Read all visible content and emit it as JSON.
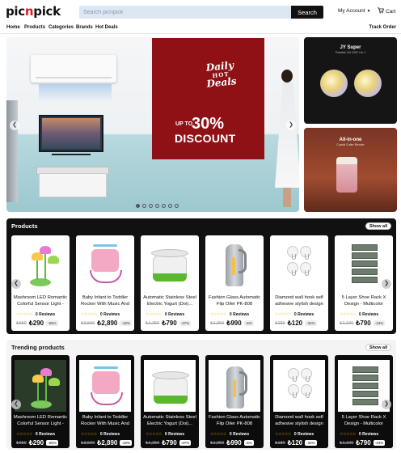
{
  "header": {
    "logo": {
      "part1": "pic",
      "part2": "n",
      "part3": "pick"
    },
    "search": {
      "placeholder": "Search picnpick",
      "button": "Search"
    },
    "account": "My Account",
    "cart": "Cart"
  },
  "nav": {
    "links": [
      "Home",
      "Products",
      "Categories",
      "Brands",
      "Hot Deals"
    ],
    "track": "Track Order"
  },
  "hero": {
    "promo": {
      "daily": "Daily",
      "hot": "HOT",
      "deals": "Deals",
      "up_to": "UP TO",
      "percent": "30%",
      "discount": "DISCOUNT"
    },
    "slide_count": 7,
    "active_slide": 1,
    "side_banners": [
      {
        "title": "JY Super",
        "subtitle": "Portable JUI GHR 4 in 1"
      },
      {
        "title": "All-in-one",
        "subtitle": "Crystal Cutter Blender"
      }
    ]
  },
  "sections": {
    "products": {
      "title": "Products",
      "show_all": "Show all"
    },
    "trending": {
      "title": "Trending products",
      "show_all": "Show all"
    }
  },
  "products": [
    {
      "name": "Mashroom LED Romantic Colorful Sensor Light -",
      "rating_stars": "☆☆☆☆☆",
      "reviews": "0 Reviews",
      "old_price": "₺650",
      "price": "₺290",
      "discount": "-55%"
    },
    {
      "name": "Baby Infant to Toddler Rocker With Music And",
      "rating_stars": "☆☆☆☆☆",
      "reviews": "0 Reviews",
      "old_price": "₺3,500",
      "price": "₺2,890",
      "discount": "-18%"
    },
    {
      "name": "Automatic Stainless Steel Electric Yogurt (Doi)...",
      "rating_stars": "☆☆☆☆☆",
      "reviews": "0 Reviews",
      "old_price": "₺1,250",
      "price": "₺790",
      "discount": "-37%"
    },
    {
      "name": "Fashion Glass Automatic Flip Oiler PK-808",
      "rating_stars": "☆☆☆☆☆",
      "reviews": "0 Reviews",
      "old_price": "₺1,050",
      "price": "₺990",
      "discount": "-6%"
    },
    {
      "name": "Diamond wall hook self adhesive stylish design",
      "rating_stars": "☆☆☆☆☆",
      "reviews": "0 Reviews",
      "old_price": "₺180",
      "price": "₺120",
      "discount": "-34%"
    },
    {
      "name": "5 Layer Shoe Rack X Design - Multicolor",
      "rating_stars": "☆☆☆☆☆",
      "reviews": "0 Reviews",
      "old_price": "₺1,190",
      "price": "₺790",
      "discount": "-34%"
    }
  ],
  "trending": [
    {
      "name": "Mashroom LED Romantic Colorful Sensor Light -",
      "rating_stars": "☆☆☆☆☆",
      "reviews": "0 Reviews",
      "old_price": "₺650",
      "price": "₺290",
      "discount": "-55%"
    },
    {
      "name": "Baby Infant to Toddler Rocker With Music And",
      "rating_stars": "☆☆☆☆☆",
      "reviews": "0 Reviews",
      "old_price": "₺3,500",
      "price": "₺2,890",
      "discount": "-18%"
    },
    {
      "name": "Automatic Stainless Steel Electric Yogurt (Doi)...",
      "rating_stars": "☆☆☆☆☆",
      "reviews": "0 Reviews",
      "old_price": "₺1,250",
      "price": "₺790",
      "discount": "-37%"
    },
    {
      "name": "Fashion Glass Automatic Flip Oiler PK-808",
      "rating_stars": "☆☆☆☆☆",
      "reviews": "0 Reviews",
      "old_price": "₺1,050",
      "price": "₺990",
      "discount": "-6%"
    },
    {
      "name": "Diamond wall hook self adhesive stylish design",
      "rating_stars": "☆☆☆☆☆",
      "reviews": "0 Reviews",
      "old_price": "₺180",
      "price": "₺120",
      "discount": "-34%"
    },
    {
      "name": "5 Layer Shoe Rack X Design - Multicolor",
      "rating_stars": "☆☆☆☆☆",
      "reviews": "0 Reviews",
      "old_price": "₺1,190",
      "price": "₺790",
      "discount": "-34%"
    }
  ],
  "icons": {
    "prev": "chevron-left-icon",
    "next": "chevron-right-icon",
    "account_chevron": "chevron-down-icon",
    "cart": "cart-icon"
  },
  "colors": {
    "brand_red": "#e31b23",
    "promo_red": "#8f1116",
    "dark": "#111111",
    "search_bg": "#dde7f4",
    "star": "#f5b400"
  }
}
